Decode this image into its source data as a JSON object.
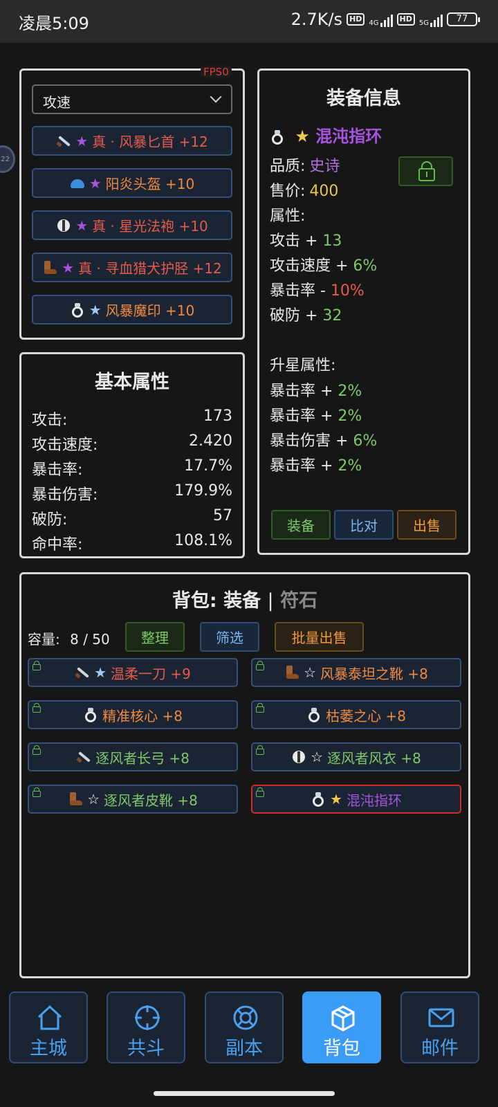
{
  "status_bar": {
    "time": "凌晨5:09",
    "speed": "2.7K/s",
    "hd": "HD",
    "net1": "4G",
    "net2": "5G",
    "battery": "77"
  },
  "fps": "FPS0",
  "side_bubble": "22",
  "equipped": {
    "filter": "攻速",
    "items": [
      {
        "prefix": "★",
        "name": "真 · 风暴匕首 +12"
      },
      {
        "prefix": "★",
        "name": "阳炎头盔 +10"
      },
      {
        "prefix": "★",
        "name": "真 · 星光法袍 +10"
      },
      {
        "prefix": "★",
        "name": "真 · 寻血猎犬护胫 +12"
      },
      {
        "prefix": "★",
        "name": "风暴魔印 +10"
      }
    ]
  },
  "base_stats": {
    "title": "基本属性",
    "rows": [
      {
        "label": "攻击:",
        "value": "173"
      },
      {
        "label": "攻击速度:",
        "value": "2.420"
      },
      {
        "label": "暴击率:",
        "value": "17.7%"
      },
      {
        "label": "暴击伤害:",
        "value": "179.9%"
      },
      {
        "label": "破防:",
        "value": "57"
      },
      {
        "label": "命中率:",
        "value": "108.1%"
      }
    ]
  },
  "equip_info": {
    "title": "装备信息",
    "star": "★",
    "item_name": "混沌指环",
    "quality_label": "品质:",
    "quality_value": "史诗",
    "price_label": "售价:",
    "price_value": "400",
    "attr_label": "属性:",
    "attrs": [
      {
        "name": "攻击 + ",
        "value": "13"
      },
      {
        "name": "攻击速度 + ",
        "value": "6%"
      },
      {
        "name": "暴击率 - ",
        "value": "10%"
      },
      {
        "name": "破防 + ",
        "value": "32"
      }
    ],
    "star_attr_label": "升星属性:",
    "star_attrs": [
      {
        "name": "暴击率 + ",
        "value": "2%"
      },
      {
        "name": "暴击率 + ",
        "value": "2%"
      },
      {
        "name": "暴击伤害 + ",
        "value": "6%"
      },
      {
        "name": "暴击率 + ",
        "value": "2%"
      }
    ],
    "buttons": {
      "equip": "装备",
      "compare": "比对",
      "sell": "出售"
    }
  },
  "bag": {
    "title_prefix": "背包:",
    "tab_equip": "装备",
    "sep": "|",
    "tab_rune": "符石",
    "capacity_label": "容量:",
    "capacity_value": "8 / 50",
    "btn_sort": "整理",
    "btn_filter": "筛选",
    "btn_bulk_sell": "批量出售",
    "items": [
      {
        "star": "★",
        "name": "温柔一刀 +9"
      },
      {
        "star": "☆",
        "name": "风暴泰坦之靴 +8"
      },
      {
        "star": "",
        "name": "精准核心 +8"
      },
      {
        "star": "",
        "name": "枯萎之心 +8"
      },
      {
        "star": "",
        "name": "逐风者长弓 +8"
      },
      {
        "star": "☆",
        "name": "逐风者风衣 +8"
      },
      {
        "star": "☆",
        "name": "逐风者皮靴 +8"
      },
      {
        "star": "★",
        "name": "混沌指环"
      }
    ]
  },
  "nav": {
    "home": "主城",
    "coop": "共斗",
    "dungeon": "副本",
    "bag": "背包",
    "mail": "邮件"
  }
}
